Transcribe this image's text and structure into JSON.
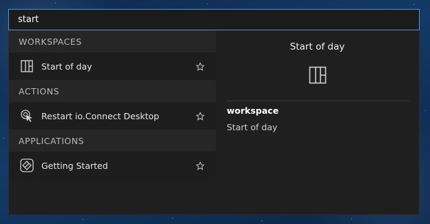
{
  "search": {
    "value": "start"
  },
  "sections": [
    {
      "header": "WORKSPACES",
      "items": [
        {
          "label": "Start of day",
          "icon": "workspace-layout-icon",
          "favorite": false
        }
      ]
    },
    {
      "header": "ACTIONS",
      "items": [
        {
          "label": "Restart io.Connect Desktop",
          "icon": "restart-cursor-icon",
          "favorite": false
        }
      ]
    },
    {
      "header": "APPLICATIONS",
      "items": [
        {
          "label": "Getting Started",
          "icon": "getting-started-app-icon",
          "favorite": false
        }
      ]
    }
  ],
  "preview": {
    "title": "Start of day",
    "icon": "workspace-layout-icon",
    "type_label": "workspace",
    "type_value": "Start of day"
  },
  "colors": {
    "accent": "#5a8fd8",
    "panel": "#1f1f1f",
    "header": "#262626"
  }
}
